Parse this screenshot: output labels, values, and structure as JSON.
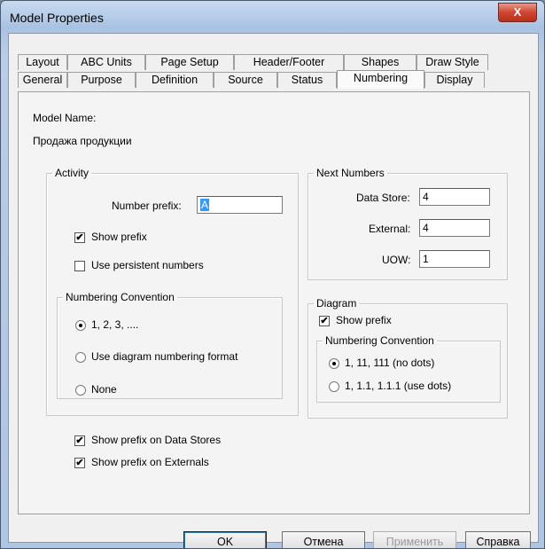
{
  "window": {
    "title": "Model Properties",
    "close_label": "X"
  },
  "tabs_back": [
    "Layout",
    "ABC Units",
    "Page Setup",
    "Header/Footer",
    "Shapes",
    "Draw Style"
  ],
  "tabs_front": [
    "General",
    "Purpose",
    "Definition",
    "Source",
    "Status",
    "Numbering",
    "Display"
  ],
  "selected_tab": "Numbering",
  "model": {
    "label": "Model Name:",
    "value": "Продажа продукции"
  },
  "activity": {
    "legend": "Activity",
    "number_prefix_label": "Number prefix:",
    "number_prefix_value": "A",
    "show_prefix": {
      "label": "Show prefix",
      "checked": true
    },
    "use_persistent": {
      "label": "Use persistent numbers",
      "checked": false
    },
    "convention": {
      "legend": "Numbering Convention",
      "options": [
        "1, 2, 3, ....",
        "Use diagram numbering format",
        "None"
      ],
      "selected": 0
    }
  },
  "next_numbers": {
    "legend": "Next Numbers",
    "data_store_label": "Data Store:",
    "data_store_value": "4",
    "external_label": "External:",
    "external_value": "4",
    "uow_label": "UOW:",
    "uow_value": "1"
  },
  "diagram": {
    "legend": "Diagram",
    "show_prefix": {
      "label": "Show prefix",
      "checked": true
    },
    "convention": {
      "legend": "Numbering Convention",
      "options": [
        "1, 11, 111 (no dots)",
        "1, 1.1, 1.1.1 (use dots)"
      ],
      "selected": 0
    }
  },
  "show_prefix_data_stores": {
    "label": "Show prefix on Data Stores",
    "checked": true
  },
  "show_prefix_externals": {
    "label": "Show prefix on Externals",
    "checked": true
  },
  "buttons": {
    "ok": "OK",
    "cancel": "Отмена",
    "apply": "Применить",
    "help": "Справка"
  },
  "check_glyph": "✔"
}
